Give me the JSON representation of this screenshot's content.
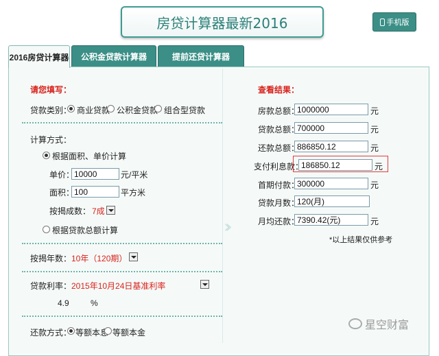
{
  "header": {
    "title": "房贷计算器最新2016",
    "mobile_label": "手机版"
  },
  "tabs": [
    {
      "label": "2016房贷计算器"
    },
    {
      "label": "公积金贷款计算器"
    },
    {
      "label": "提前还贷计算器"
    }
  ],
  "left": {
    "section_title": "请您填写：",
    "loan_type_label": "贷款类别：",
    "loan_types": [
      "商业贷款",
      "公积金贷款",
      "组合型贷款"
    ],
    "calc_method_label": "计算方式：",
    "method_area": "根据面积、单价计算",
    "unit_price_label": "单价：",
    "unit_price_value": "10000",
    "unit_price_unit": "元/平米",
    "area_label": "面积：",
    "area_value": "100",
    "area_unit": "平方米",
    "ratio_label": "按揭成数：",
    "ratio_value": "7成",
    "method_total": "根据贷款总额计算",
    "years_label": "按揭年数：",
    "years_value": "10年（120期）",
    "rate_label": "贷款利率：",
    "rate_value": "2015年10月24日基准利率",
    "rate_percent": "4.9",
    "rate_percent_unit": "%",
    "repay_label": "还款方式：",
    "repay_options": [
      "等额本息",
      "等额本金"
    ]
  },
  "right": {
    "section_title": "查看结果：",
    "rows": [
      {
        "label": "房款总额：",
        "value": "1000000",
        "unit": "元"
      },
      {
        "label": "贷款总额：",
        "value": "700000",
        "unit": "元"
      },
      {
        "label": "还款总额：",
        "value": "886850.12",
        "unit": "元"
      },
      {
        "label": "支付利息款：",
        "value": "186850.12",
        "unit": "元"
      },
      {
        "label": "首期付款：",
        "value": "300000",
        "unit": "元"
      },
      {
        "label": "贷款月数：",
        "value": "120(月)",
        "unit": ""
      },
      {
        "label": "月均还款：",
        "value": "7390.42(元)",
        "unit": "元"
      }
    ],
    "note": "*以上结果仅供参考"
  },
  "watermark": "星空财富"
}
